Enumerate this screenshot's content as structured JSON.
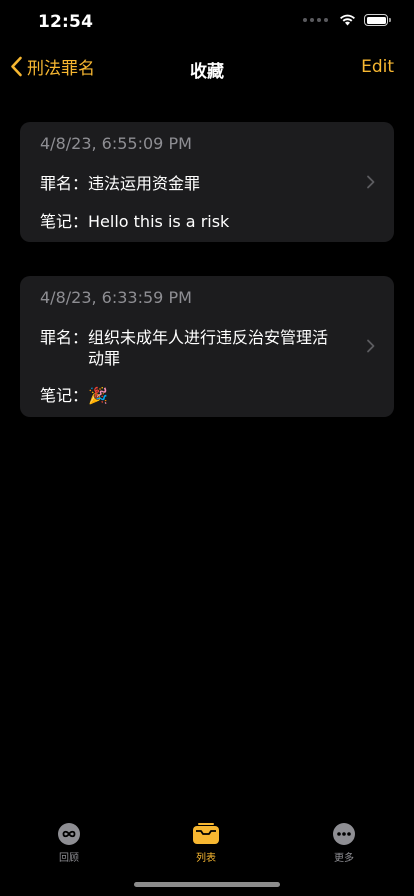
{
  "status_bar": {
    "time": "12:54"
  },
  "nav": {
    "back_label": "刑法罪名",
    "title": "收藏",
    "edit_label": "Edit"
  },
  "favorites": [
    {
      "date": "4/8/23, 6:55:09 PM",
      "crime_label": "罪名：",
      "crime": "违法运用资金罪",
      "note_label": "笔记：",
      "note": "Hello this is a risk"
    },
    {
      "date": "4/8/23, 6:33:59 PM",
      "crime_label": "罪名：",
      "crime": "组织未成年人进行违反治安管理活动罪",
      "note_label": "笔记：",
      "note": "🎉"
    }
  ],
  "tab_bar": {
    "tabs": [
      {
        "label": "回顾",
        "icon": "infinity-icon",
        "active": false
      },
      {
        "label": "列表",
        "icon": "tray-icon",
        "active": true
      },
      {
        "label": "更多",
        "icon": "ellipsis-icon",
        "active": false
      }
    ]
  },
  "colors": {
    "accent": "#f7b731",
    "card_bg": "#1c1c1e",
    "secondary_text": "#8e8e93",
    "inactive_tab": "#8e8e93"
  }
}
